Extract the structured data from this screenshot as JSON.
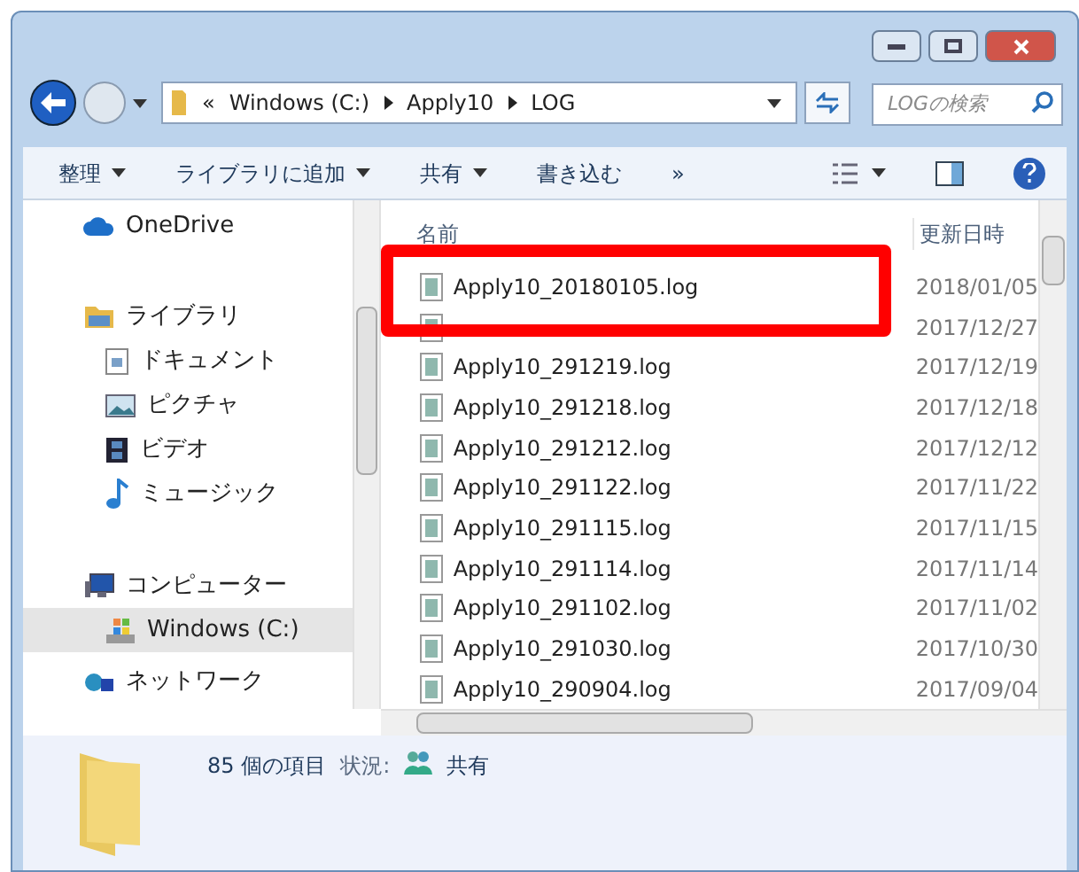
{
  "address_bar": {
    "overflow": "«",
    "path": [
      "Windows (C:)",
      "Apply10",
      "LOG"
    ]
  },
  "search": {
    "placeholder": "LOGの検索"
  },
  "toolbar": {
    "items": [
      {
        "label": "整理",
        "dropdown": true
      },
      {
        "label": "ライブラリに追加",
        "dropdown": true
      },
      {
        "label": "共有",
        "dropdown": true
      },
      {
        "label": "書き込む",
        "dropdown": false
      },
      {
        "label": "»",
        "dropdown": false
      }
    ]
  },
  "nav_pane": {
    "items": [
      {
        "label": "OneDrive",
        "kind": "cloud",
        "selected": false
      },
      {
        "label": "ライブラリ",
        "kind": "library",
        "selected": false,
        "children": [
          {
            "label": "ドキュメント",
            "kind": "document",
            "selected": false
          },
          {
            "label": "ピクチャ",
            "kind": "picture",
            "selected": false
          },
          {
            "label": "ビデオ",
            "kind": "video",
            "selected": false
          },
          {
            "label": "ミュージック",
            "kind": "music",
            "selected": false
          }
        ]
      },
      {
        "label": "コンピューター",
        "kind": "computer",
        "selected": false,
        "children": [
          {
            "label": "Windows (C:)",
            "kind": "drive",
            "selected": true
          }
        ]
      },
      {
        "label": "ネットワーク",
        "kind": "network",
        "selected": false
      }
    ]
  },
  "file_list": {
    "columns": [
      "名前",
      "更新日時"
    ],
    "rows": [
      {
        "name": "Apply10_20180105.log",
        "date": "2018/01/05"
      },
      {
        "date": "2017/12/27"
      },
      {
        "name": "Apply10_291219.log",
        "date": "2017/12/19"
      },
      {
        "name": "Apply10_291218.log",
        "date": "2017/12/18"
      },
      {
        "name": "Apply10_291212.log",
        "date": "2017/12/12"
      },
      {
        "name": "Apply10_291122.log",
        "date": "2017/11/22"
      },
      {
        "name": "Apply10_291115.log",
        "date": "2017/11/15"
      },
      {
        "name": "Apply10_291114.log",
        "date": "2017/11/14"
      },
      {
        "name": "Apply10_291102.log",
        "date": "2017/11/02"
      },
      {
        "name": "Apply10_291030.log",
        "date": "2017/10/30"
      },
      {
        "name": "Apply10_290904.log",
        "date": "2017/09/04"
      }
    ]
  },
  "details_pane": {
    "count": "85 個の項目",
    "status_label": "状況:",
    "status_value": "共有"
  }
}
